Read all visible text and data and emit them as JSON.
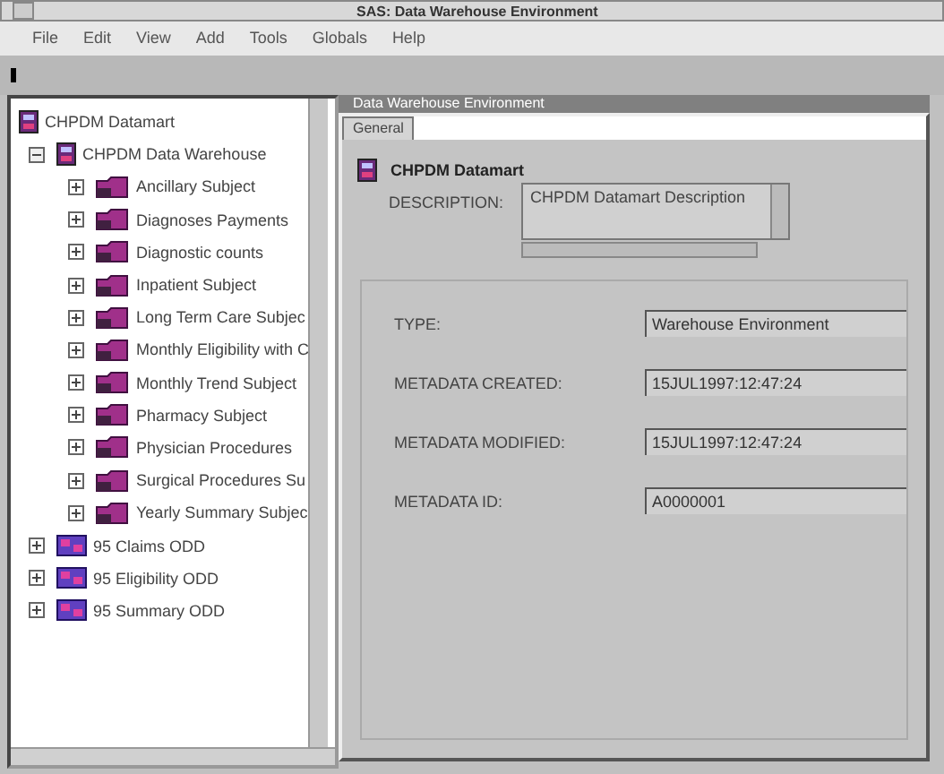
{
  "window": {
    "title": "SAS: Data Warehouse Environment"
  },
  "menu": [
    "File",
    "Edit",
    "View",
    "Add",
    "Tools",
    "Globals",
    "Help"
  ],
  "tree": [
    {
      "label": "CHPDM Datamart",
      "kind": "datamart",
      "children": [
        {
          "label": "CHPDM Data Warehouse",
          "kind": "warehouse",
          "expanded": true,
          "children": [
            {
              "label": "Ancillary Subject",
              "kind": "subject",
              "expanded": false
            },
            {
              "label": "Diagnoses Payments",
              "kind": "subject",
              "expanded": false
            },
            {
              "label": "Diagnostic counts",
              "kind": "subject",
              "expanded": false
            },
            {
              "label": "Inpatient  Subject",
              "kind": "subject",
              "expanded": false
            },
            {
              "label": "Long Term Care Subjec",
              "kind": "subject",
              "expanded": false
            },
            {
              "label": "Monthly Eligibility with C",
              "kind": "subject",
              "expanded": false
            },
            {
              "label": "Monthly Trend Subject",
              "kind": "subject",
              "expanded": false
            },
            {
              "label": "Pharmacy Subject",
              "kind": "subject",
              "expanded": false
            },
            {
              "label": "Physician Procedures",
              "kind": "subject",
              "expanded": false
            },
            {
              "label": "Surgical Procedures Su",
              "kind": "subject",
              "expanded": false
            },
            {
              "label": "Yearly Summary Subjec",
              "kind": "subject",
              "expanded": false
            }
          ]
        },
        {
          "label": "95 Claims ODD",
          "kind": "odd",
          "expanded": false
        },
        {
          "label": "95 Eligibility ODD",
          "kind": "odd",
          "expanded": false
        },
        {
          "label": "95 Summary ODD",
          "kind": "odd",
          "expanded": false
        }
      ]
    }
  ],
  "detail": {
    "title": "Data Warehouse Environment",
    "tabs": [
      {
        "label": "General",
        "selected": true
      }
    ],
    "heading": "CHPDM Datamart",
    "description_label": "DESCRIPTION:",
    "description": "CHPDM Datamart Description",
    "fields": [
      {
        "label": "TYPE:",
        "value": "Warehouse Environment"
      },
      {
        "label": "METADATA CREATED:",
        "value": "15JUL1997:12:47:24"
      },
      {
        "label": "METADATA MODIFIED:",
        "value": "15JUL1997:12:47:24"
      },
      {
        "label": "METADATA ID:",
        "value": "A0000001"
      }
    ]
  }
}
